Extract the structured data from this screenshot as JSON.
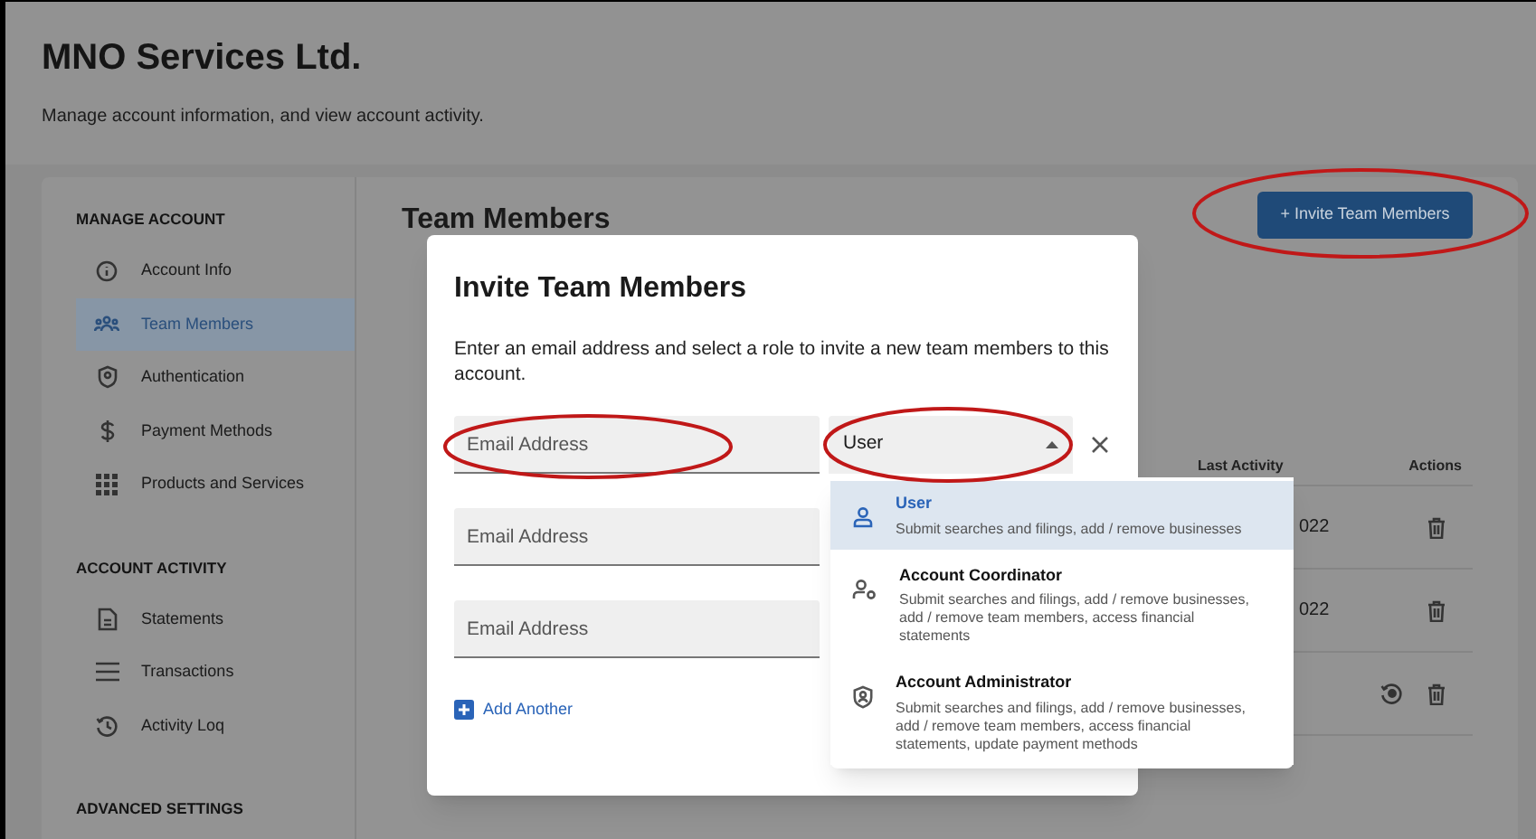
{
  "header": {
    "title": "MNO Services Ltd.",
    "subtitle": "Manage account information, and view account activity."
  },
  "sidebar": {
    "sections": [
      {
        "heading": "MANAGE ACCOUNT",
        "items": [
          {
            "label": "Account Info",
            "selected": false
          },
          {
            "label": "Team Members",
            "selected": true
          },
          {
            "label": "Authentication",
            "selected": false
          },
          {
            "label": "Payment Methods",
            "selected": false
          },
          {
            "label": "Products and Services",
            "selected": false
          }
        ]
      },
      {
        "heading": "ACCOUNT ACTIVITY",
        "items": [
          {
            "label": "Statements",
            "selected": false
          },
          {
            "label": "Transactions",
            "selected": false
          },
          {
            "label": "Activity Loq",
            "selected": false
          }
        ]
      },
      {
        "heading": "ADVANCED SETTINGS"
      }
    ]
  },
  "main": {
    "title": "Team Members",
    "invite_button": "+ Invite Team Members"
  },
  "table": {
    "columns": [
      "Last Activity",
      "Actions"
    ],
    "rows": [
      {
        "last_activity": "022",
        "restore_action": false,
        "delete_action": true
      },
      {
        "last_activity": "022",
        "restore_action": false,
        "delete_action": true
      },
      {
        "restore_action": true,
        "delete_action": true
      }
    ]
  },
  "modal": {
    "title": "Invite Team Members",
    "description": "Enter an email address and select a role to invite a new team members to this account.",
    "email_fields": [
      {
        "placeholder": "Email Address"
      },
      {
        "placeholder": "Email Address"
      },
      {
        "placeholder": "Email Address"
      }
    ],
    "role_select": {
      "value": "User",
      "expanded": true
    },
    "add_another": "Add Another",
    "role_options": [
      {
        "title": "User",
        "description": "Submit searches and filings, add / remove businesses",
        "selected": true
      },
      {
        "title": "Account Coordinator",
        "description": "Submit searches and filings, add / remove businesses, add / remove team members, access financial statements",
        "selected": false
      },
      {
        "title": "Account Administrator",
        "description": "Submit searches and filings, add / remove businesses, add / remove team members, access financial statements, update payment methods",
        "selected": false
      }
    ]
  }
}
